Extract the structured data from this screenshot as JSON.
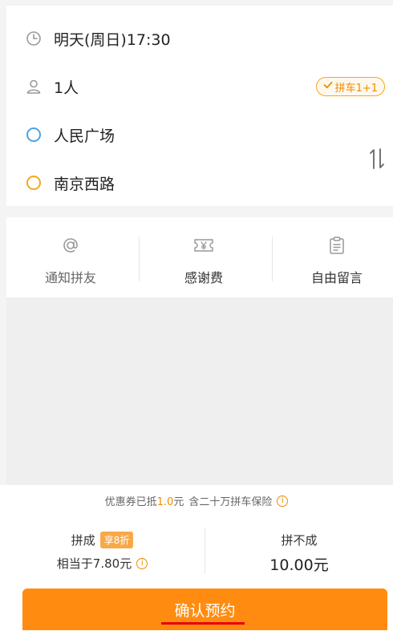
{
  "trip": {
    "time": "明天(周日)17:30",
    "passengers": "1人",
    "carpool_badge": "拼车1+1",
    "start": "人民广场",
    "end": "南京西路"
  },
  "actions": {
    "notify": "通知拼友",
    "thanks": "感谢费",
    "message": "自由留言"
  },
  "pricing": {
    "coupon_prefix": "优惠券已抵",
    "coupon_amount": "1.0",
    "coupon_unit": "元",
    "insurance": "含二十万拼车保险",
    "success_label": "拼成",
    "discount_tag": "享8折",
    "success_price": "相当于7.80元",
    "fail_label": "拼不成",
    "fail_price": "10.00元"
  },
  "confirm_label": "确认预约",
  "colors": {
    "accent": "#ff8c10",
    "start_dot": "#4aa3e8",
    "end_dot": "#f5a623",
    "underline": "#e8000b"
  }
}
